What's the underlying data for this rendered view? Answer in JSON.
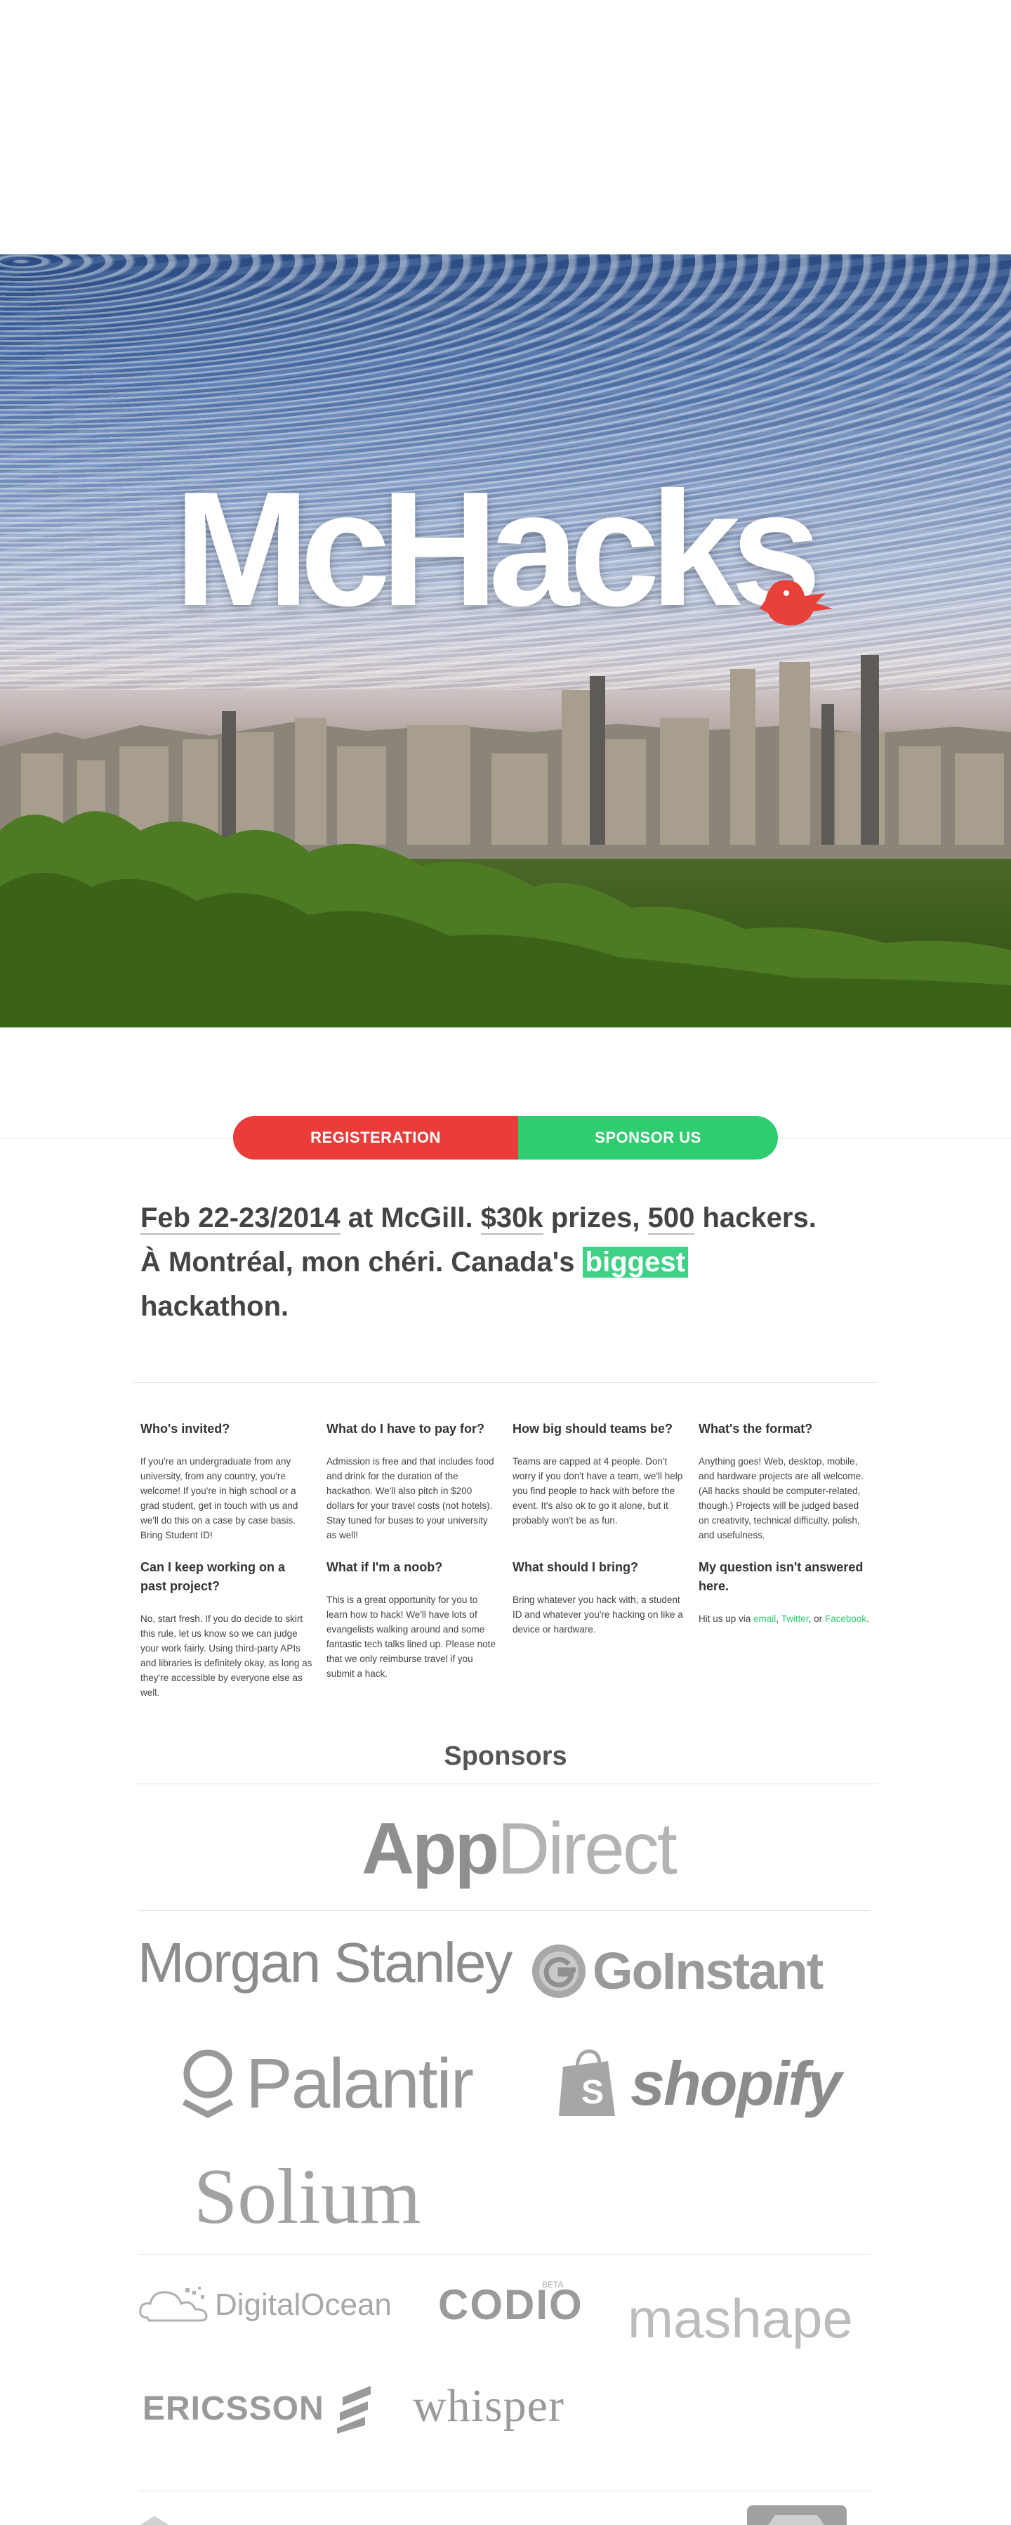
{
  "hero": {
    "logo_text": "McHacks"
  },
  "cta": {
    "register_label": "REGISTERATION",
    "sponsor_label": "SPONSOR US"
  },
  "intro": {
    "date": "Feb 22-23/2014",
    "at": " at McGill. ",
    "prize": "$30k",
    "prizes_word": " prizes, ",
    "count": "500",
    "hackers_word": " hackers.",
    "line2_a": "À Montréal, mon chéri. Canada's ",
    "highlight": "biggest",
    "line3": "hackathon."
  },
  "faq": [
    {
      "q": "Who's invited?",
      "a": "If you're an undergraduate from any university, from any country, you're welcome! If you're in high school or a grad student, get in touch with us and we'll do this on a case by case basis. Bring Student ID!"
    },
    {
      "q": "What do I have to pay for?",
      "a": "Admission is free and that includes food and drink for the duration of the hackathon. We'll also pitch in $200 dollars for your travel costs (not hotels). Stay tuned for buses to your university as well!"
    },
    {
      "q": "How big should teams be?",
      "a": "Teams are capped at 4 people. Don't worry if you don't have a team, we'll help you find people to hack with before the event. It's also ok to go it alone, but it probably won't be as fun."
    },
    {
      "q": "What's the format?",
      "a": "Anything goes! Web, desktop, mobile, and hardware projects are all welcome. (All hacks should be computer-related, though.) Projects will be judged based on creativity, technical difficulty, polish, and usefulness."
    },
    {
      "q": "Can I keep working on a past project?",
      "a": "No, start fresh. If you do decide to skirt this rule, let us know so we can judge your work fairly. Using third-party APIs and libraries is definitely okay, as long as they're accessible by everyone else as well."
    },
    {
      "q": "What if I'm a noob?",
      "a": "This is a great opportunity for you to learn how to hack! We'll have lots of evangelists walking around and some fantastic tech talks lined up. Please note that we only reimburse travel if you submit a hack."
    },
    {
      "q": "What should I bring?",
      "a": "Bring whatever you hack with, a student ID and whatever you're hacking on like a device or hardware."
    },
    {
      "q": "My question isn't answered here.",
      "a_prefix": "Hit us up via ",
      "link_email": "email",
      "sep1": ", ",
      "link_twitter": "Twitter",
      "sep2": ", or ",
      "link_facebook": "Facebook",
      "a_suffix": "."
    }
  ],
  "sponsors": {
    "title": "Sponsors",
    "appdirect_a": "App",
    "appdirect_b": "Direct",
    "morgan_stanley": "Morgan Stanley",
    "goinstant": "GoInstant",
    "palantir": "Palantir",
    "shopify": "shopify",
    "solium": "Solium",
    "digitalocean": "DigitalOcean",
    "codio": "CODIO",
    "codio_beta": "BETA",
    "mashape": "mashape",
    "ericsson": "ERICSSON",
    "whisper": "whisper"
  },
  "colors": {
    "register": "#ea3d3a",
    "sponsor": "#2fcd70",
    "highlight": "#3fd286",
    "bird": "#e8413a"
  }
}
